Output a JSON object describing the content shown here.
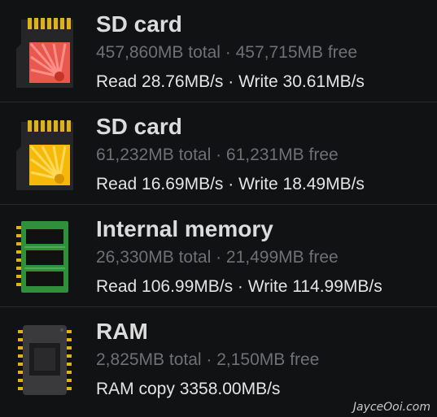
{
  "storage_items": [
    {
      "title": "SD card",
      "sizes": "457,860MB total · 457,715MB free",
      "speed": "Read 28.76MB/s · Write 30.61MB/s",
      "icon": "sd-card-red-icon",
      "accent": "#e2453f"
    },
    {
      "title": "SD card",
      "sizes": "61,232MB total · 61,231MB free",
      "speed": "Read 16.69MB/s · Write 18.49MB/s",
      "icon": "sd-card-yellow-icon",
      "accent": "#f5b400"
    },
    {
      "title": "Internal memory",
      "sizes": "26,330MB total · 21,499MB free",
      "speed": "Read 106.99MB/s · Write 114.99MB/s",
      "icon": "memory-chip-icon",
      "accent": "#2f8f3a"
    },
    {
      "title": "RAM",
      "sizes": "2,825MB total · 2,150MB free",
      "speed": "RAM copy 3358.00MB/s",
      "icon": "ram-chip-icon",
      "accent": "#d6a31a"
    }
  ],
  "watermark": "JayceOoi.com"
}
